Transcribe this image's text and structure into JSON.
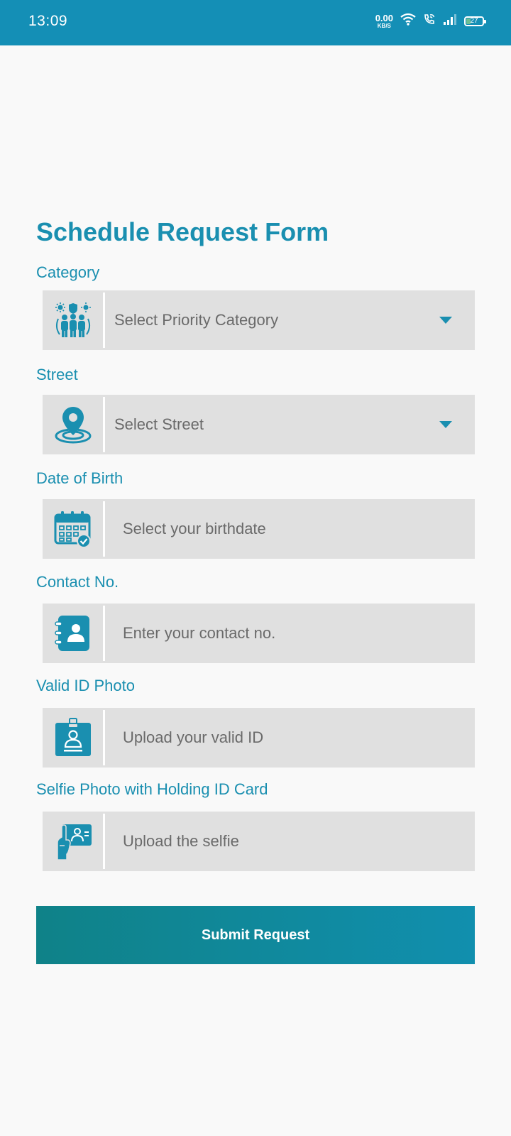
{
  "status_bar": {
    "time": "13:09",
    "net_speed": "0.00",
    "net_unit": "KB/S",
    "battery_level": "27"
  },
  "form": {
    "title": "Schedule Request Form",
    "fields": [
      {
        "label": "Category",
        "text": "Select Priority Category",
        "icon": "priority-category-icon",
        "kind": "select"
      },
      {
        "label": "Street",
        "text": "Select Street",
        "icon": "location-pin-icon",
        "kind": "select"
      },
      {
        "label": "Date of Birth",
        "text": "Select your birthdate",
        "icon": "calendar-icon",
        "kind": "input"
      },
      {
        "label": "Contact No.",
        "text": "Enter your contact no.",
        "icon": "contact-book-icon",
        "kind": "input"
      },
      {
        "label": "Valid ID Photo",
        "text": "Upload your valid ID",
        "icon": "id-card-icon",
        "kind": "input"
      },
      {
        "label": "Selfie Photo with Holding ID Card",
        "text": "Upload the selfie",
        "icon": "hand-holding-id-icon",
        "kind": "input"
      }
    ],
    "submit_label": "Submit Request"
  },
  "colors": {
    "accent": "#1a8fb0",
    "status_bar": "#148fb6",
    "field_bg": "#e0e0e0",
    "submit_start": "#0f8288",
    "submit_end": "#118fae"
  }
}
